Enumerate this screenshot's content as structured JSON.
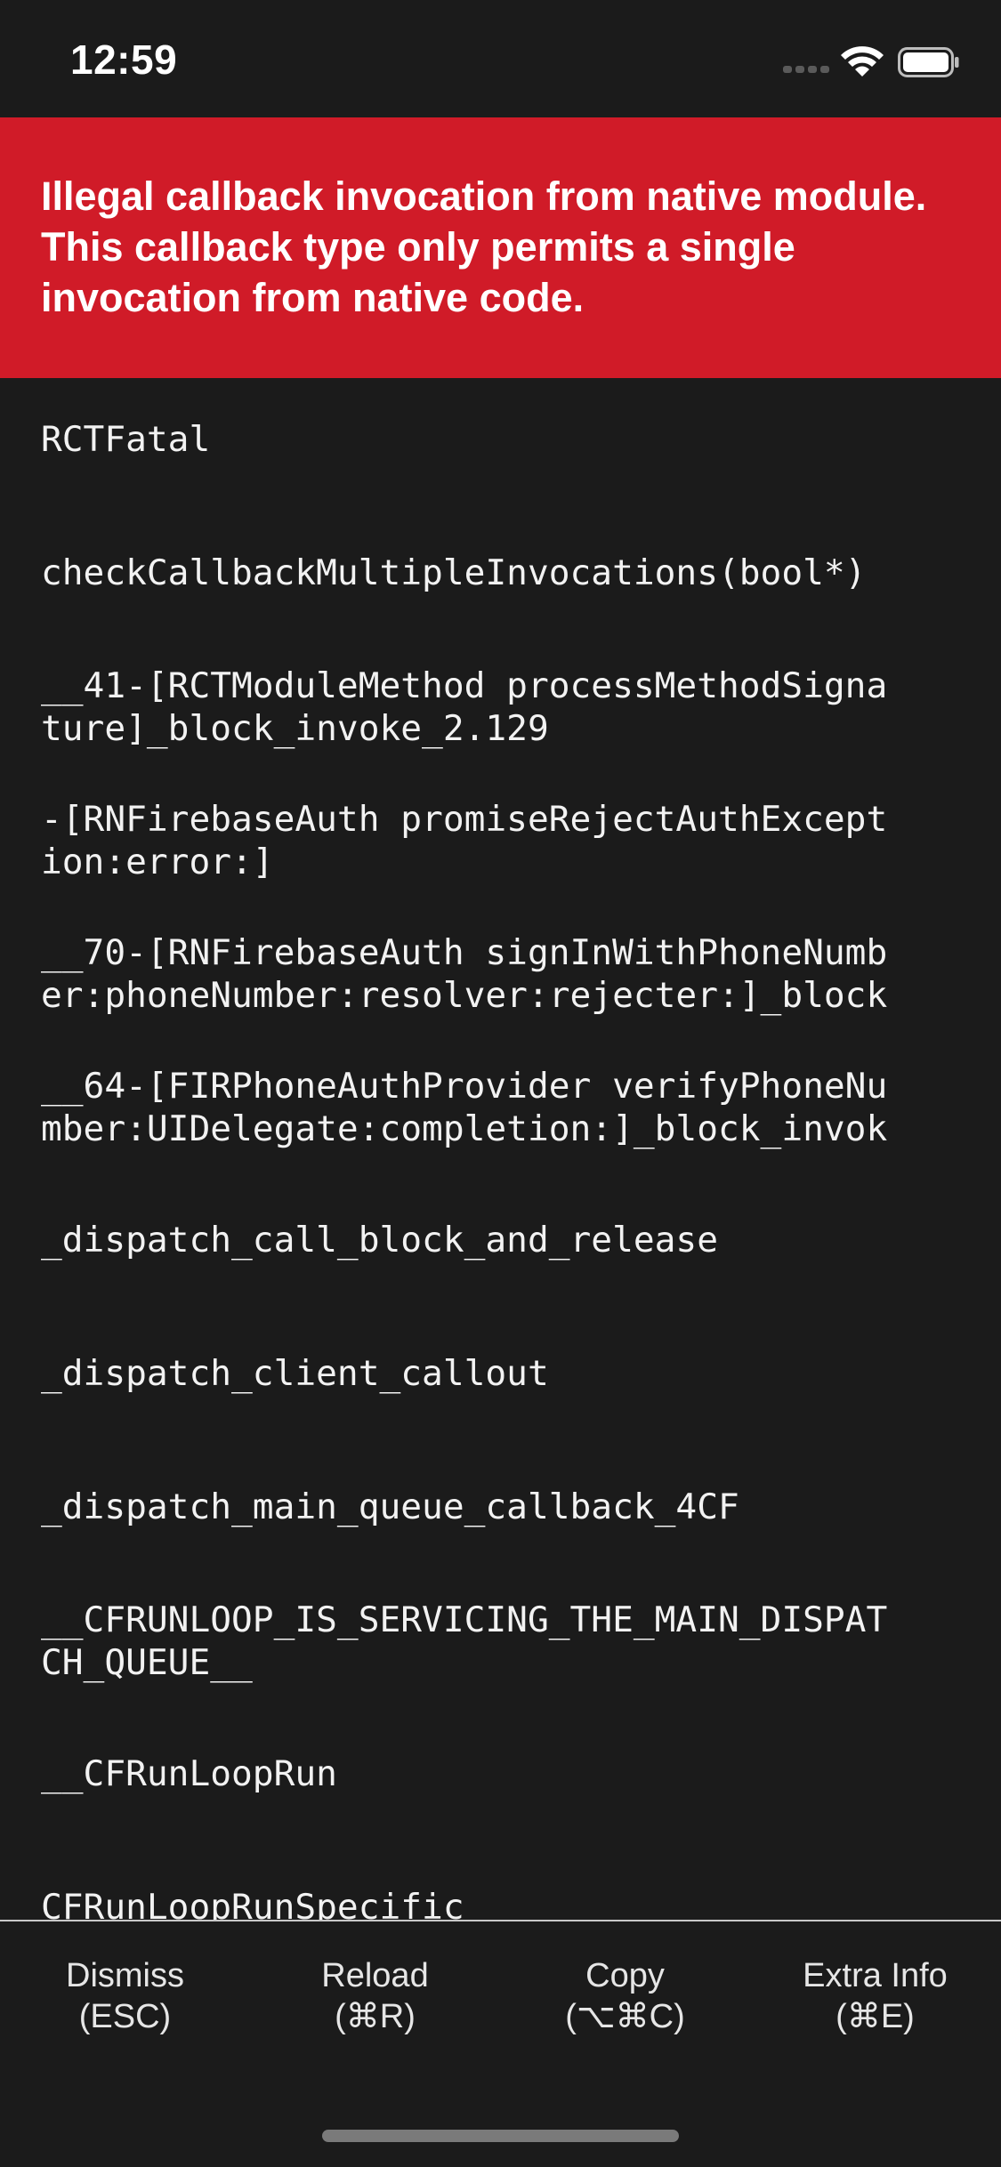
{
  "status_bar": {
    "time": "12:59",
    "icons": [
      "cellular-signal-icon",
      "wifi-icon",
      "battery-icon"
    ]
  },
  "error": {
    "message": "Illegal callback invocation from native module. This callback type only permits a single invocation from native code.",
    "header_color": "#d01b28"
  },
  "stack_frames": [
    "RCTFatal",
    "checkCallbackMultipleInvocations(bool*)",
    "__41-[RCTModuleMethod processMethodSigna\nture]_block_invoke_2.129",
    "-[RNFirebaseAuth promiseRejectAuthExcept\nion:error:]",
    "__70-[RNFirebaseAuth signInWithPhoneNumb\ner:phoneNumber:resolver:rejecter:]_block",
    "__64-[FIRPhoneAuthProvider verifyPhoneNu\nmber:UIDelegate:completion:]_block_invok",
    "_dispatch_call_block_and_release",
    "_dispatch_client_callout",
    "_dispatch_main_queue_callback_4CF",
    "__CFRUNLOOP_IS_SERVICING_THE_MAIN_DISPAT\nCH_QUEUE__",
    "__CFRunLoopRun",
    "CFRunLoopRunSpecific"
  ],
  "toolbar": {
    "dismiss": {
      "label": "Dismiss",
      "shortcut": "(ESC)"
    },
    "reload": {
      "label": "Reload",
      "shortcut": "(⌘R)"
    },
    "copy": {
      "label": "Copy",
      "shortcut": "(⌥⌘C)"
    },
    "extra_info": {
      "label": "Extra Info",
      "shortcut": "(⌘E)"
    }
  },
  "colors": {
    "background": "#1b1b1b",
    "error_red": "#d01b28",
    "text": "#ffffff"
  }
}
